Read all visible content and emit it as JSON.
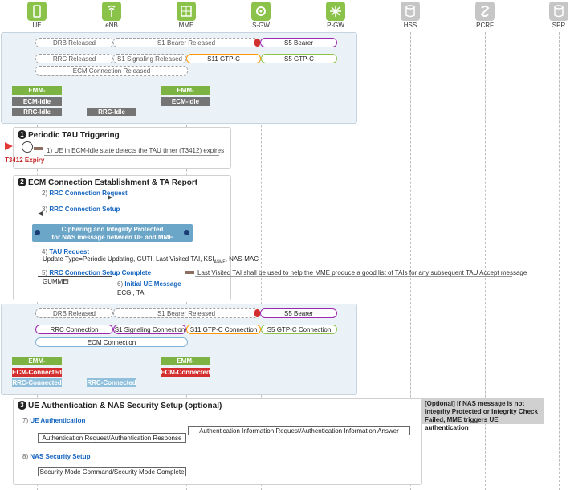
{
  "nodes": [
    {
      "id": "ue",
      "label": "UE"
    },
    {
      "id": "enb",
      "label": "eNB"
    },
    {
      "id": "mme",
      "label": "MME"
    },
    {
      "id": "sgw",
      "label": "S-GW"
    },
    {
      "id": "pgw",
      "label": "P-GW"
    },
    {
      "id": "hss",
      "label": "HSS"
    },
    {
      "id": "pcrf",
      "label": "PCRF"
    },
    {
      "id": "spr",
      "label": "SPR"
    }
  ],
  "top_panel": {
    "drb": "DRB Released",
    "s1_bearer": "S1 Bearer Released",
    "s5_bearer": "S5 Bearer",
    "rrc": "RRC  Released",
    "s1_sig": "S1 Signaling Released",
    "s11": "S11 GTP-C",
    "s5_gtpc": "S5 GTP-C",
    "ecm": "ECM Connection Released",
    "ue_emm": "EMM-Registered",
    "ue_ecm": "ECM-Idle",
    "ue_rrc": "RRC-Idle",
    "enb_rrc": "RRC-Idle",
    "mme_emm": "EMM-Registered",
    "mme_ecm": "ECM-Idle"
  },
  "sec1": {
    "num": "1",
    "title": "Periodic TAU Triggering",
    "step": "1) UE in ECM-Idle state detects the TAU timer (T3412) expires",
    "expiry": "T3412 Expiry"
  },
  "sec2": {
    "num": "2",
    "title": "ECM Connection Establishment & TA Report",
    "s2n": "2)",
    "s2": "RRC Connection Request",
    "s3n": "3)",
    "s3": "RRC Connection Setup",
    "cipher1": "Ciphering and Integrity Protected",
    "cipher2": "for NAS message between UE and MME",
    "s4n": "4)",
    "s4": "TAU Request",
    "s4d": "Update Type=Periodic Updating, GUTI, Last Visited TAI, KSI",
    "s4sub": "ASME",
    "s4d2": ", NAS-MAC",
    "s5n": "5)",
    "s5": "RRC Connection Setup Complete",
    "s5d": "GUMMEI",
    "s6n": "6)",
    "s6": "Initial UE Message",
    "s6d": "ECGI, TAI",
    "note": "Last Visited TAI shall be used to help the MME produce a good list of TAIs for any subsequent TAU Accept message"
  },
  "mid_panel": {
    "drb": "DRB Released",
    "s1_bearer": "S1 Bearer Released",
    "s5_bearer": "S5 Bearer",
    "rrc": "RRC Connection",
    "s1_sig": "S1 Signaling Connection",
    "s11": "S11 GTP-C Connection",
    "s5_gtpc": "S5 GTP-C Connection",
    "ecm": "ECM Connection",
    "ue_emm": "EMM-Registered",
    "ue_ecm": "ECM-Connected",
    "ue_rrc": "RRC-Connected",
    "enb_rrc": "RRC-Connected",
    "mme_emm": "EMM-Registered",
    "mme_ecm": "ECM-Connected"
  },
  "sec3": {
    "num": "3",
    "title": "UE Authentication & NAS Security Setup (optional)",
    "s7n": "7)",
    "s7": "UE Authentication",
    "auth": "Authentication Request/Authentication Response",
    "air": "Authentication Information Request/Authentication Information Answer",
    "s8n": "8)",
    "s8": "NAS Security Setup",
    "smc": "Security Mode Command/Security Mode Complete",
    "note": "[Optional] If NAS message is not Integrity Protected or Integrity Check Failed, MME triggers UE authentication"
  },
  "colors": {
    "green": "#7cb342",
    "grey": "#757575",
    "red": "#d32f2f",
    "lightblue": "#90c0dc",
    "step_blue": "#1565c0",
    "cipher": "#6ba5c7"
  }
}
